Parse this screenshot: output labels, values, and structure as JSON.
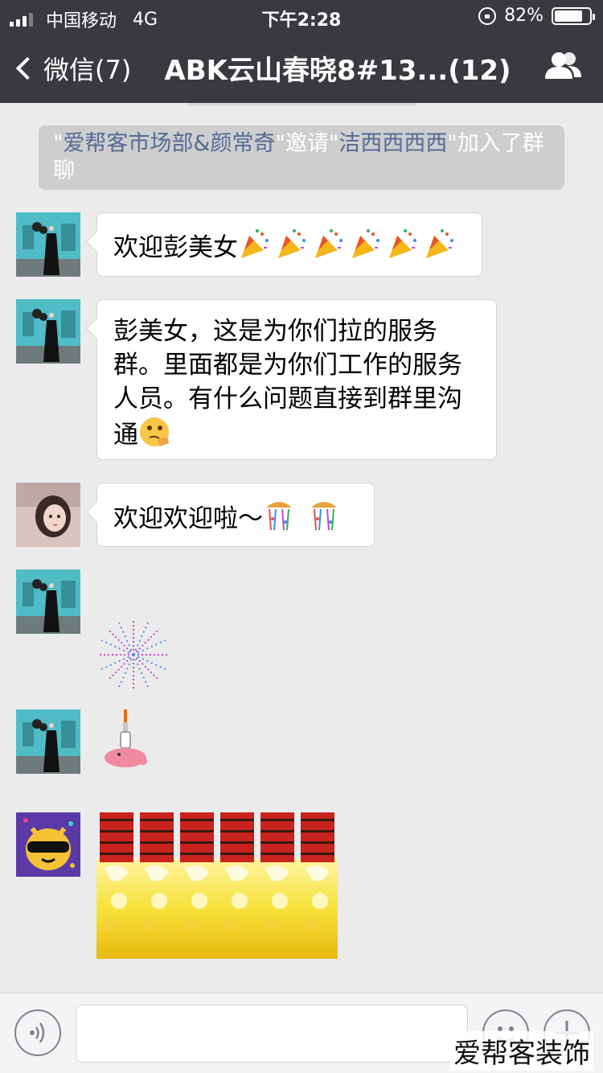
{
  "status_bar": {
    "carrier": "中国移动",
    "network": "4G",
    "time": "下午2:28",
    "battery": "82%",
    "battery_level": 0.82
  },
  "nav": {
    "back_label": "微信(7)",
    "title": "ABK云山春晓8#13...(12)"
  },
  "system_message": {
    "quote1": "\"",
    "inviter": "爱帮客市场部&颜常奇",
    "quote2": "\"邀请\"",
    "invitee": "洁西西西西",
    "suffix": "\"加入了群聊"
  },
  "messages": [
    {
      "text": "欢迎彭美女",
      "emoji": "party-popper x6"
    },
    {
      "text": "彭美女，这是为你们拉的服务群。里面都是为你们工作的服务人员。有什么问题直接到群里沟通",
      "emoji": "thinking-face"
    },
    {
      "text": "欢迎欢迎啦～",
      "emoji": "confetti-ball x2"
    },
    {
      "text": "",
      "emoji": "fireworks-sticker"
    },
    {
      "text": "",
      "emoji": "firecracker-sticker"
    },
    {
      "text": "",
      "emoji": "firecrackers-animation"
    }
  ],
  "input": {
    "value": ""
  },
  "watermark": "爱帮客装饰",
  "colors": {
    "header_bg": "#393a3f",
    "chat_bg": "#ebebeb",
    "link": "#576b95",
    "system_bg": "#cecece"
  }
}
